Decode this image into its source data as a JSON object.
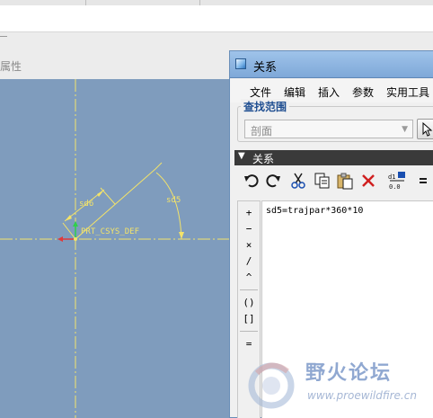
{
  "background_app": {
    "properties_label": "属性",
    "sketch": {
      "csys_label": "PRT_CSYS_DEF",
      "dimensions": [
        "sd6",
        "sd5"
      ]
    }
  },
  "dialog": {
    "title": "关系",
    "menu": [
      "文件",
      "编辑",
      "插入",
      "参数",
      "实用工具"
    ],
    "scope_group": {
      "label": "查找范围",
      "selected_value": "剖面"
    },
    "relations_section": {
      "label": "关系"
    },
    "toolbar_icons": [
      "undo-icon",
      "redo-icon",
      "cut-icon",
      "copy-icon",
      "paste-icon",
      "delete-icon",
      "dimension-display-icon"
    ],
    "operators": [
      "+",
      "−",
      "×",
      "/",
      "^",
      "()",
      "[]",
      "="
    ],
    "editor_text": "sd5=trajpar*360*10"
  },
  "watermark": {
    "title": "野火论坛",
    "url": "www.proewildfire.cn"
  },
  "colors": {
    "viewport_bg": "#7f9cbd",
    "sketch_line": "#f3e36a",
    "dialog_titlebar": "#8fb5e2",
    "section_header": "#3a3a3a",
    "accent_text": "#1f4e91"
  }
}
